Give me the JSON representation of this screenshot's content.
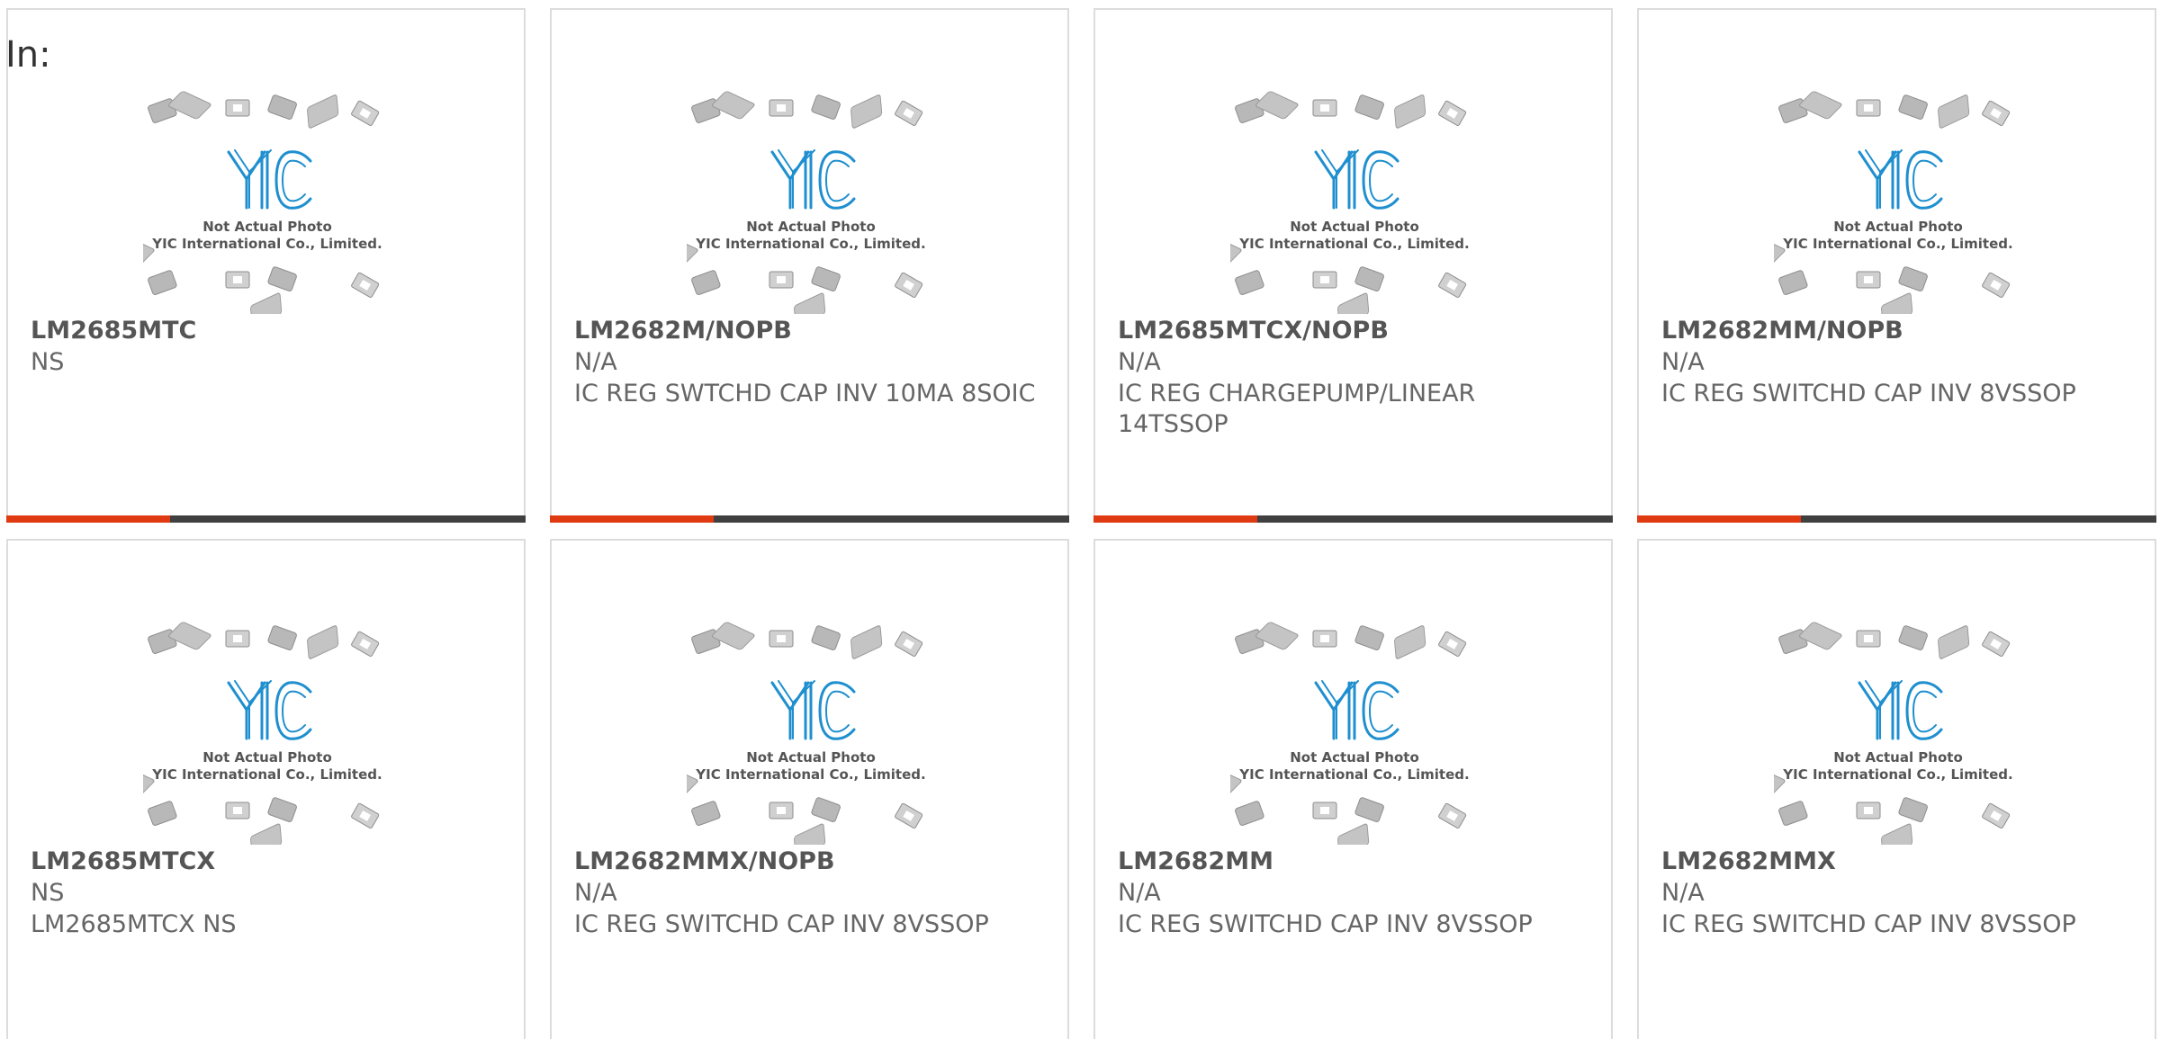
{
  "page": {
    "heading": "In:"
  },
  "colors": {
    "accent_bar": "#e03a12",
    "dark_bar": "#404040",
    "logo_blue": "#1f8fcf"
  },
  "placeholder_image": {
    "icon": "yic-not-actual-photo",
    "line1": "Not Actual Photo",
    "line2": "YIC International Co., Limited."
  },
  "products": [
    {
      "part": "LM2685MTC",
      "maker": "NS",
      "desc": ""
    },
    {
      "part": "LM2682M/NOPB",
      "maker": "N/A",
      "desc": "IC REG SWTCHD CAP INV 10MA 8SOIC"
    },
    {
      "part": "LM2685MTCX/NOPB",
      "maker": "N/A",
      "desc": "IC REG CHARGEPUMP/LINEAR 14TSSOP"
    },
    {
      "part": "LM2682MM/NOPB",
      "maker": "N/A",
      "desc": "IC REG SWITCHD CAP INV 8VSSOP"
    },
    {
      "part": "LM2685MTCX",
      "maker": "NS",
      "desc": "LM2685MTCX NS"
    },
    {
      "part": "LM2682MMX/NOPB",
      "maker": "N/A",
      "desc": "IC REG SWITCHD CAP INV 8VSSOP"
    },
    {
      "part": "LM2682MM",
      "maker": "N/A",
      "desc": "IC REG SWITCHD CAP INV 8VSSOP"
    },
    {
      "part": "LM2682MMX",
      "maker": "N/A",
      "desc": "IC REG SWITCHD CAP INV 8VSSOP"
    }
  ]
}
